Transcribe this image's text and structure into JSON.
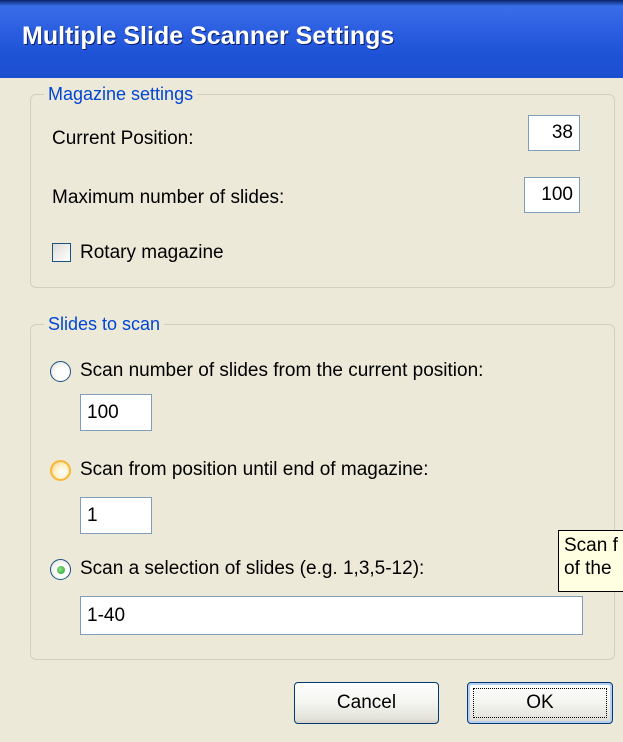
{
  "window": {
    "title": "Multiple Slide Scanner Settings"
  },
  "magazine": {
    "legend": "Magazine settings",
    "current_position_label": "Current Position:",
    "current_position_value": "38",
    "max_slides_label": "Maximum number of slides:",
    "max_slides_value": "100",
    "rotary_label": "Rotary magazine",
    "rotary_checked": false
  },
  "scan": {
    "legend": "Slides to scan",
    "option1_label": "Scan number of slides from the current position:",
    "option1_value": "100",
    "option2_label": "Scan from position until end of magazine:",
    "option2_value": "1",
    "option3_label": "Scan a selection of slides (e.g. 1,3,5-12):",
    "option3_value": "1-40",
    "selected_option": 3
  },
  "tooltip": {
    "line1": "Scan f",
    "line2": "of the"
  },
  "buttons": {
    "cancel": "Cancel",
    "ok": "OK"
  },
  "colors": {
    "titlebar": "#1f53d7",
    "legend_text": "#0046d5",
    "dialog_bg": "#ece9d8",
    "tooltip_bg": "#ffffe1"
  }
}
